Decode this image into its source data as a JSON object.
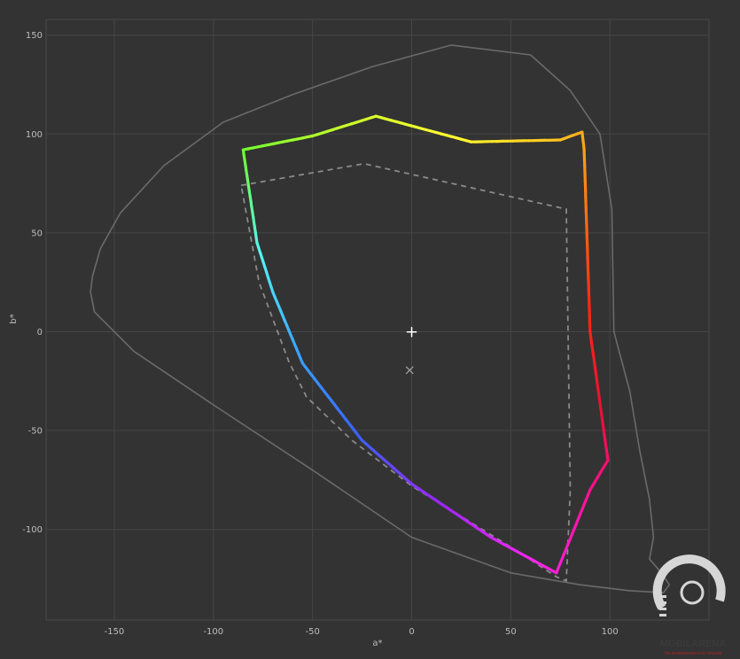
{
  "chart_data": {
    "type": "line",
    "xlabel": "a*",
    "ylabel": "b*",
    "xlim": [
      -185,
      150
    ],
    "ylim": [
      -145,
      160
    ],
    "xticks": [
      -150,
      -100,
      -50,
      0,
      50,
      100
    ],
    "yticks": [
      -100,
      -50,
      0,
      50,
      100,
      150
    ],
    "xtick_labels": [
      "-150",
      "-100",
      "-50",
      "0",
      "50",
      "100"
    ],
    "ytick_labels": [
      "-100",
      "-50",
      "0",
      "50",
      "100",
      "150"
    ],
    "grid": true,
    "series": [
      {
        "role": "visible-spectrum-outline",
        "color": "#6a6a6a",
        "style": "solid",
        "points": [
          [
            -162,
            20
          ],
          [
            -161,
            28
          ],
          [
            -157,
            42
          ],
          [
            -147,
            60
          ],
          [
            -125,
            84
          ],
          [
            -95,
            106
          ],
          [
            -60,
            120
          ],
          [
            -20,
            134
          ],
          [
            20,
            145
          ],
          [
            60,
            140
          ],
          [
            80,
            122
          ],
          [
            95,
            100
          ],
          [
            101,
            62
          ],
          [
            102,
            0
          ],
          [
            110,
            -30
          ],
          [
            115,
            -60
          ],
          [
            120,
            -85
          ],
          [
            122,
            -104
          ],
          [
            120,
            -115
          ],
          [
            126,
            -122
          ],
          [
            130,
            -128
          ],
          [
            127,
            -132
          ],
          [
            110,
            -131
          ],
          [
            85,
            -128
          ],
          [
            50,
            -122
          ],
          [
            0,
            -104
          ],
          [
            -50,
            -70
          ],
          [
            -100,
            -37
          ],
          [
            -140,
            -10
          ],
          [
            -160,
            10
          ],
          [
            -162,
            20
          ]
        ]
      },
      {
        "role": "reference-gamut",
        "color": "#8a8a8a",
        "style": "dashed",
        "points": [
          [
            -86,
            74
          ],
          [
            -24,
            85
          ],
          [
            78,
            62
          ],
          [
            80,
            -80
          ],
          [
            78,
            -126
          ],
          [
            73,
            -124
          ],
          [
            55,
            -112
          ],
          [
            0,
            -78
          ],
          [
            -30,
            -55
          ],
          [
            -53,
            -33
          ],
          [
            -62,
            -15
          ],
          [
            -77,
            25
          ],
          [
            -86,
            74
          ]
        ]
      },
      {
        "role": "measured-gamut",
        "style": "solid",
        "color_stops": [
          "#72ff2f",
          "#c8ff2a",
          "#ffff30",
          "#ffc820",
          "#ff7a14",
          "#ff2a12",
          "#e81034",
          "#ff12a0",
          "#f226f0",
          "#9d26ff",
          "#3a62ff",
          "#3aa4ff",
          "#55f4f4",
          "#72ff2f"
        ],
        "points": [
          [
            -85,
            92
          ],
          [
            -50,
            99
          ],
          [
            -18,
            109
          ],
          [
            30,
            96
          ],
          [
            75,
            97
          ],
          [
            86,
            101
          ],
          [
            87,
            92
          ],
          [
            90,
            0
          ],
          [
            99,
            -65
          ],
          [
            90,
            -80
          ],
          [
            73,
            -122
          ],
          [
            40,
            -104
          ],
          [
            0,
            -77
          ],
          [
            -25,
            -55
          ],
          [
            -55,
            -16
          ],
          [
            -70,
            20
          ],
          [
            -78,
            45
          ],
          [
            -85,
            92
          ]
        ]
      }
    ],
    "markers": [
      {
        "name": "white-point-target",
        "symbol": "+",
        "x": 0,
        "y": 0,
        "color": "#ffffff"
      },
      {
        "name": "measured-white-point",
        "symbol": "×",
        "x": -1,
        "y": -19,
        "color": "#9a9a9a"
      }
    ]
  },
  "watermark": {
    "brand": "MOBILARENA",
    "tagline": "TELEKOMMUNIKÁCIÓ ONLINE",
    "brand_color": "#4a4a4a",
    "tagline_color": "#c02020"
  }
}
